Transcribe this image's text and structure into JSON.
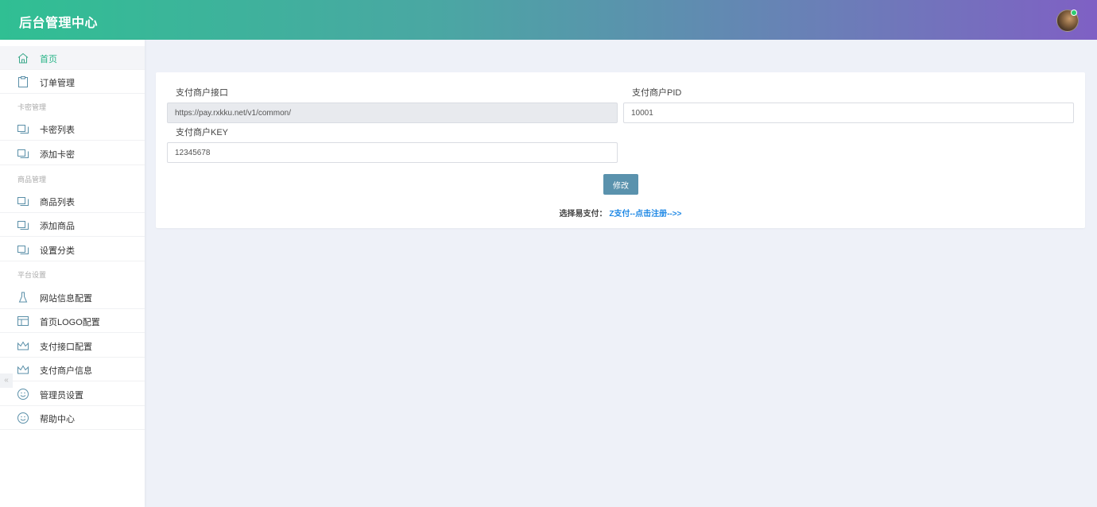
{
  "header": {
    "title": "后台管理中心"
  },
  "sidebar": {
    "items": [
      {
        "label": "首页",
        "icon": "home-icon"
      },
      {
        "label": "订单管理",
        "icon": "clipboard-icon"
      },
      {
        "label": "卡密列表",
        "icon": "copy-icon"
      },
      {
        "label": "添加卡密",
        "icon": "copy-icon"
      },
      {
        "label": "商品列表",
        "icon": "copy-icon"
      },
      {
        "label": "添加商品",
        "icon": "copy-icon"
      },
      {
        "label": "设置分类",
        "icon": "copy-icon"
      },
      {
        "label": "网站信息配置",
        "icon": "flask-icon"
      },
      {
        "label": "首页LOGO配置",
        "icon": "layout-icon"
      },
      {
        "label": "支付接口配置",
        "icon": "crown-icon"
      },
      {
        "label": "支付商户信息",
        "icon": "crown-icon"
      },
      {
        "label": "管理员设置",
        "icon": "smile-icon"
      },
      {
        "label": "帮助中心",
        "icon": "smile-icon"
      }
    ],
    "sections": [
      "卡密管理",
      "商品管理",
      "平台设置"
    ],
    "collapse_glyph": "«"
  },
  "form": {
    "api_label": "支付商户接口",
    "api_value": "https://pay.rxkku.net/v1/common/",
    "pid_label": "支付商户PID",
    "pid_value": "10001",
    "key_label": "支付商户KEY",
    "key_value": "12345678",
    "submit_label": "修改",
    "note_prefix": "选择易支付：",
    "note_link": "Z支付--点击注册-->>"
  },
  "colors": {
    "accent": "#28b487",
    "button": "#5a92ad",
    "link": "#1e88e5"
  }
}
